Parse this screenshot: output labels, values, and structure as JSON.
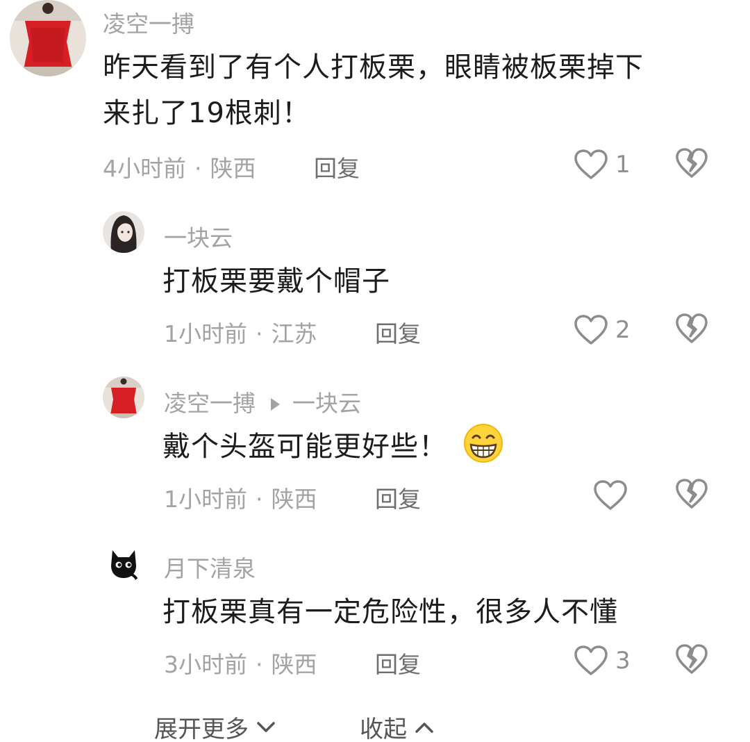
{
  "comments": [
    {
      "username": "凌空一搏",
      "text": "昨天看到了有个人打板栗，眼睛被板栗掉下来扎了19根刺！",
      "text_line1": "昨天看到了有个人打板栗，眼睛被板栗掉下",
      "text_line2": "来扎了19根刺！",
      "time": "4小时前",
      "location": "陕西",
      "reply_label": "回复",
      "likes": "1",
      "avatar": "red-dress-avatar"
    },
    {
      "username": "一块云",
      "text": "打板栗要戴个帽子",
      "time": "1小时前",
      "location": "江苏",
      "reply_label": "回复",
      "likes": "2",
      "avatar": "anime-girl-avatar"
    },
    {
      "username": "凌空一搏",
      "reply_to": "一块云",
      "text": "戴个头盔可能更好些！",
      "emoji": "grinning-face-emoji",
      "time": "1小时前",
      "location": "陕西",
      "reply_label": "回复",
      "likes": "",
      "avatar": "red-dress-avatar"
    },
    {
      "username": "月下清泉",
      "text": "打板栗真有一定危险性，很多人不懂",
      "time": "3小时前",
      "location": "陕西",
      "reply_label": "回复",
      "likes": "3",
      "avatar": "black-cat-avatar"
    }
  ],
  "separator": "·",
  "footer": {
    "expand_label": "展开更多",
    "collapse_label": "收起"
  },
  "icons": {
    "like": "heart-outline-icon",
    "dislike": "broken-heart-icon",
    "expand": "chevron-down-icon",
    "collapse": "chevron-up-icon"
  },
  "colors": {
    "username": "#a3a3a3",
    "text": "#1c1c1c",
    "meta": "#a3a3a3",
    "icon": "#8c8c8c"
  }
}
